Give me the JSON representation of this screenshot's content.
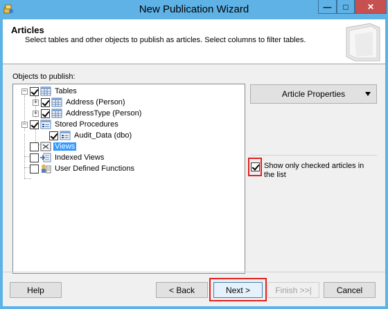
{
  "window": {
    "title": "New Publication Wizard",
    "minimize_glyph": "—",
    "maximize_glyph": "□",
    "close_glyph": "✕"
  },
  "header": {
    "title": "Articles",
    "subtitle": "Select tables and other objects to publish as articles. Select columns to filter tables."
  },
  "objects": {
    "label": "Objects to publish:",
    "tree": [
      {
        "label": "Tables",
        "checked": true,
        "expander": "−",
        "icon": "table-icon"
      },
      {
        "label": "Address (Person)",
        "checked": true,
        "expander": "+",
        "icon": "table-icon"
      },
      {
        "label": "AddressType (Person)",
        "checked": true,
        "expander": "+",
        "icon": "table-icon"
      },
      {
        "label": "Stored Procedures",
        "checked": true,
        "expander": "−",
        "icon": "stored-procedure-icon"
      },
      {
        "label": "Audit_Data (dbo)",
        "checked": true,
        "expander": "",
        "icon": "stored-procedure-icon"
      },
      {
        "label": "Views",
        "checked": false,
        "expander": "",
        "icon": "view-icon",
        "selected": true
      },
      {
        "label": "Indexed Views",
        "checked": false,
        "expander": "",
        "icon": "indexed-view-icon"
      },
      {
        "label": "User Defined Functions",
        "checked": false,
        "expander": "",
        "icon": "function-icon"
      }
    ]
  },
  "side": {
    "article_properties": "Article Properties",
    "show_checked_label": "Show only checked articles in the list",
    "show_checked": true
  },
  "footer": {
    "help": "Help",
    "back": "< Back",
    "next": "Next >",
    "finish": "Finish >>|",
    "cancel": "Cancel"
  },
  "colors": {
    "title_bar": "#5eb2e6",
    "highlight_box": "#e02020",
    "selection": "#3399ff"
  }
}
